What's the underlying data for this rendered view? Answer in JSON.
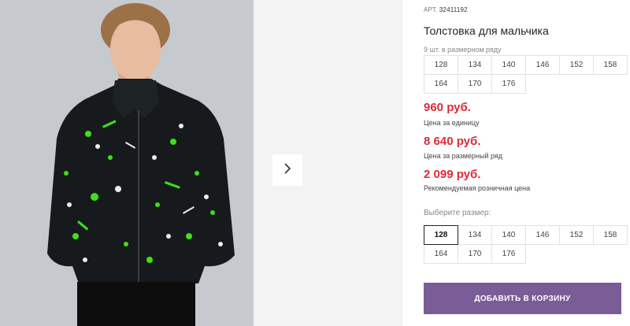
{
  "product": {
    "article_label": "АРТ.",
    "article_number": "32411192",
    "title": "Толстовка для мальчика",
    "sizes_note": "9 шт. в размерном ряду"
  },
  "size_row": [
    "128",
    "134",
    "140",
    "146",
    "152",
    "158",
    "164",
    "170",
    "176"
  ],
  "prices": [
    {
      "value": "960 руб.",
      "label": "Цена за единицу"
    },
    {
      "value": "8 640 руб.",
      "label": "Цена за размерный ряд"
    },
    {
      "value": "2 099 руб.",
      "label": "Рекомендуемая розничная цена"
    }
  ],
  "size_select": {
    "label": "Выберите размер:",
    "options": [
      "128",
      "134",
      "140",
      "146",
      "152",
      "158",
      "164",
      "170",
      "176"
    ],
    "selected": "128"
  },
  "cart_button": "ДОБАВИТЬ В КОРЗИНУ",
  "icons": {
    "gallery_next": "chevron-right-icon"
  },
  "colors": {
    "price": "#e02a36",
    "button": "#7a5c97"
  }
}
